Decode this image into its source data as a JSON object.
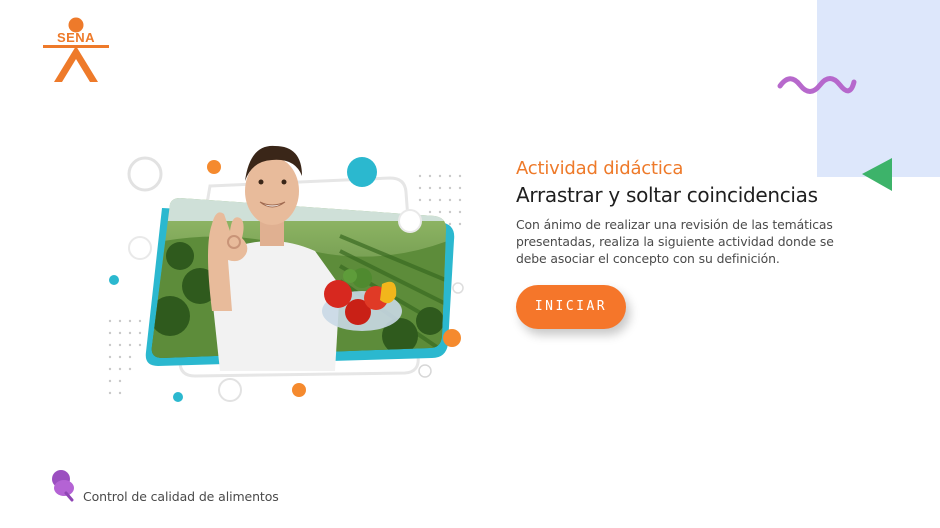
{
  "brand": {
    "logo_text": "SENA",
    "color": "#ee7a2a"
  },
  "activity": {
    "type_label": "Actividad didáctica",
    "title": "Arrastrar y soltar coincidencias",
    "description": "Con ánimo de realizar una revisión de las temáticas presentadas, realiza la siguiente actividad donde se debe asociar el concepto con su definición.",
    "start_label": "INICIAR"
  },
  "footer": {
    "course_name": "Control de calidad de alimentos",
    "icon": "thumbtack-icon"
  },
  "hero": {
    "illustration": "man-holding-vegetables"
  },
  "colors": {
    "accent": "#f5762a",
    "panel": "#dde7fb",
    "wave": "#b361c9",
    "triangle": "#3db36a",
    "cyan": "#2bb8cf"
  }
}
